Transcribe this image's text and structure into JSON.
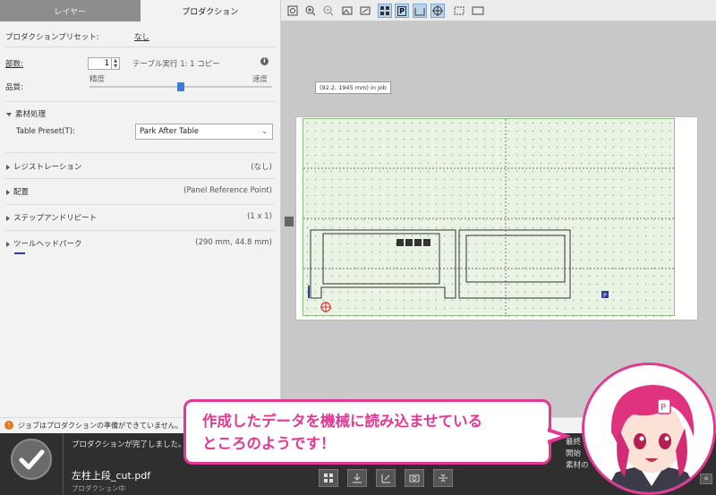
{
  "tabs": {
    "layer": "レイヤー",
    "production": "プロダクション"
  },
  "left": {
    "preset_label": "プロダクションプリセット:",
    "preset_value": "なし",
    "copies_label": "部数:",
    "copies_value": "1",
    "copies_note": "テーブル実行 1: 1 コピー",
    "quality_label": "品質:",
    "precision_label": "精度",
    "speed_label": "速度",
    "quality_level": 0.5,
    "material": "素材処理",
    "table_preset_label": "Table Preset(T):",
    "table_preset_value": "Park After Table",
    "registration": "レジストレーション",
    "registration_value": "(なし)",
    "placement": "配置",
    "placement_value": "(Panel Reference Point)",
    "step_repeat": "ステップアンドリピート",
    "step_repeat_value": "(1 x 1)",
    "toolhead_park": "ツールヘッドパーク",
    "toolhead_park_value": "(290 mm, 44.8 mm)"
  },
  "warning": "ジョブはプロダクションの準備ができていません。",
  "status": {
    "done": "プロダクションが完了しました。",
    "file": "左柱上段_cut.pdf",
    "sub": "プロダクション中",
    "right_lines": [
      "最終",
      "開始",
      "素材の"
    ]
  },
  "canvas": {
    "tooltip": "(92.2, 1945 mm) in job",
    "p_marker": "P"
  },
  "callout": {
    "line1": "作成したデータを機械に読み込ませている",
    "line2": "ところのようです！"
  },
  "colors": {
    "accent": "#e23893",
    "blue": "#3a7bd5",
    "sheet_green": "#e9f4e4",
    "status_bg": "#2f2f2f"
  }
}
